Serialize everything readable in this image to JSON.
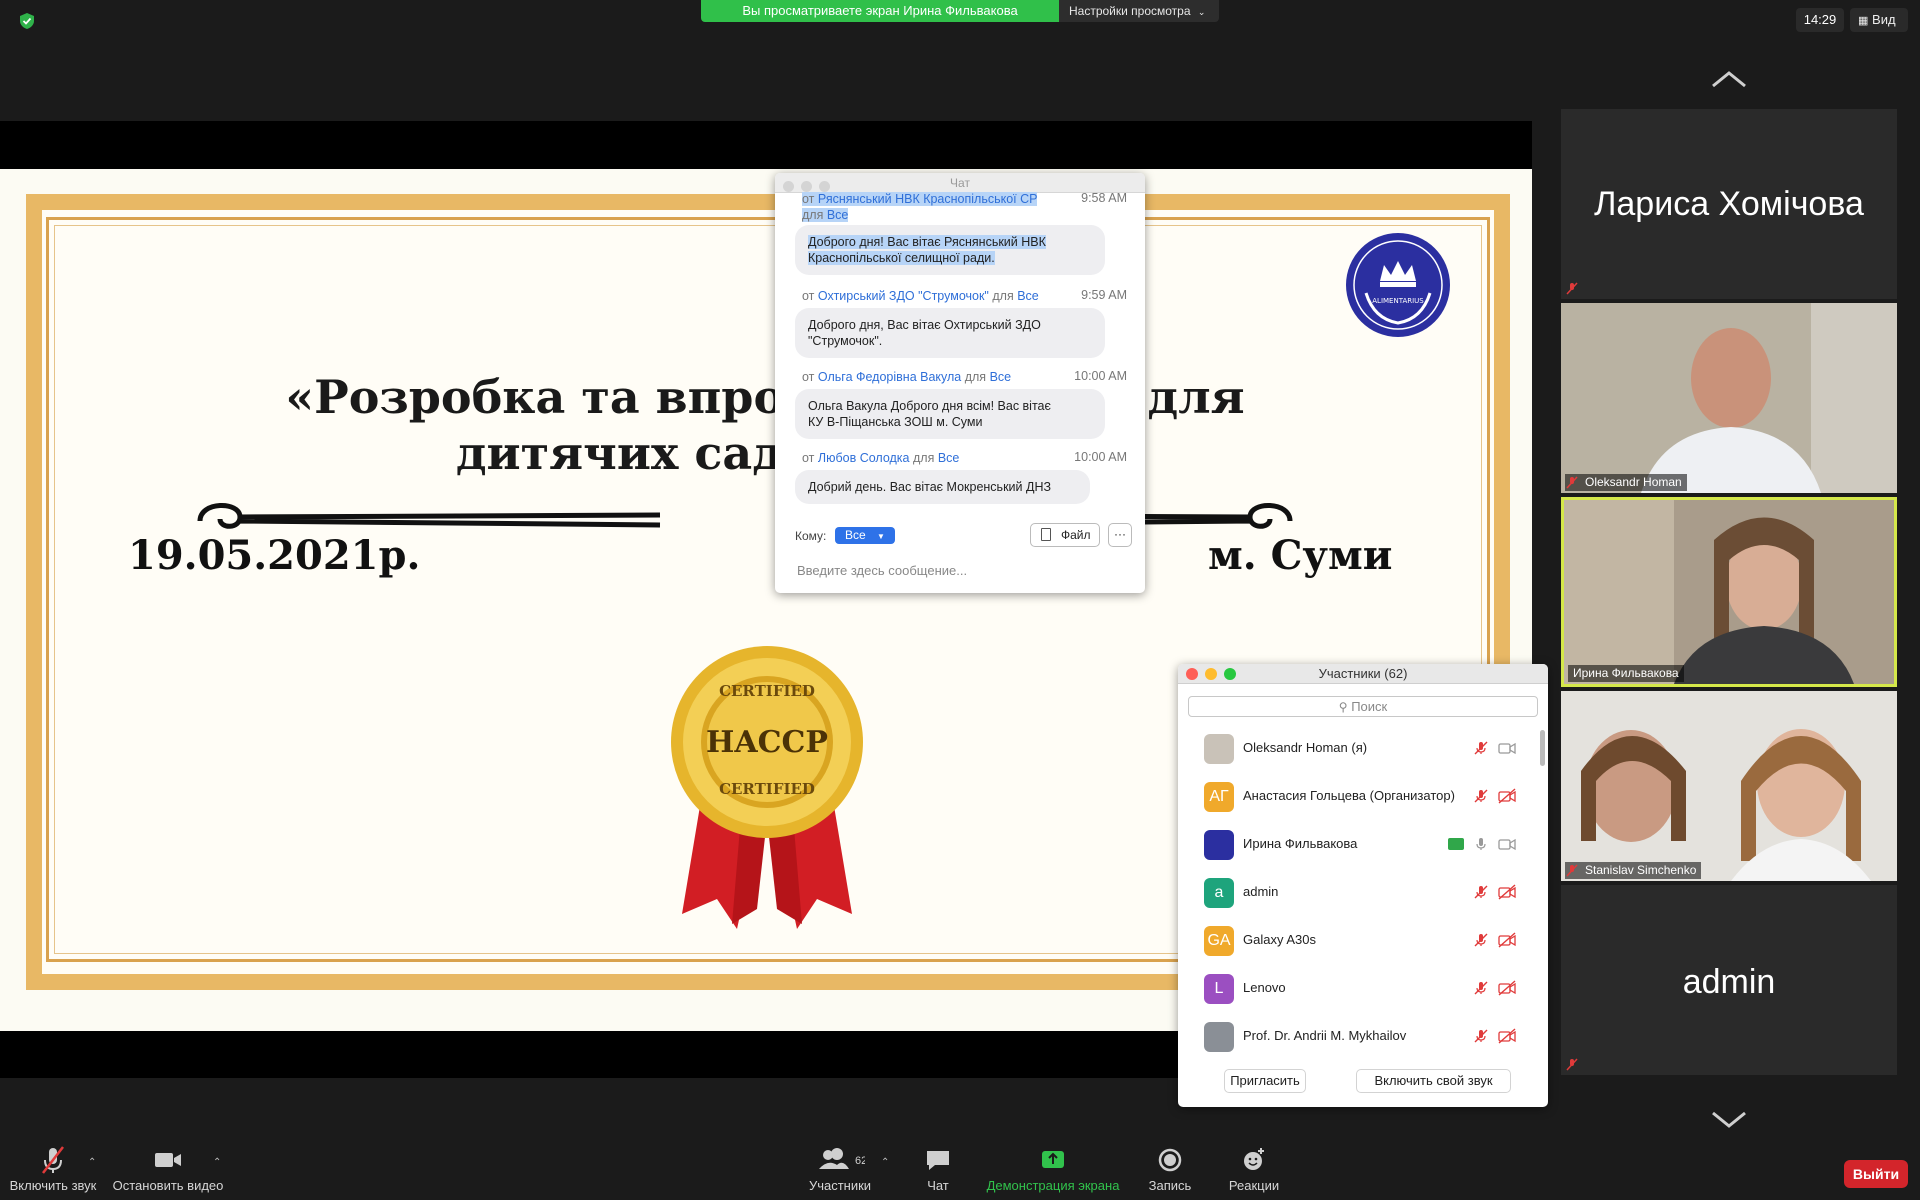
{
  "top": {
    "banner": "Вы просматриваете экран Ирина Фильвакова",
    "view_settings": "Настройки просмотра",
    "clock": "14:29",
    "view": "Вид"
  },
  "slide": {
    "title_line1": "«Розробка та впроваджен  ССР) для",
    "title_line2": "дитячих садків і ш   нь»",
    "date": "19.05.2021р.",
    "city": "м. Суми",
    "seal_top": "CERTIFIED",
    "seal_mid": "HACCP",
    "seal_bottom": "CERTIFIED",
    "logo_text": "ALIMENTARIUS"
  },
  "chat": {
    "title": "Чат",
    "messages": [
      {
        "from_prefix": "от",
        "sender": "Ряснянський НВК Краснопільської СР",
        "to_prefix": "для",
        "to": "Все",
        "time": "9:58 AM",
        "text1": "Доброго дня! Вас вітає Ряснянський НВК",
        "text2": "Краснопільської селищної ради."
      },
      {
        "from_prefix": "от",
        "sender": "Охтирський ЗДО \"Струмочок\"",
        "to_prefix": "для",
        "to": "Все",
        "time": "9:59 AM",
        "text1": "Доброго дня, Вас вітає Охтирський ЗДО",
        "text2": "\"Струмочок\"."
      },
      {
        "from_prefix": "от",
        "sender": "Ольга Федорівна Вакула",
        "to_prefix": "для",
        "to": "Все",
        "time": "10:00 AM",
        "text1": "Ольга Вакула Доброго дня всім! Вас вітає",
        "text2": "КУ В-Піщанська ЗОШ м. Суми"
      },
      {
        "from_prefix": "от",
        "sender": "Любов Солодка",
        "to_prefix": "для",
        "to": "Все",
        "time": "10:00 AM",
        "text1": "Добрий день. Вас вітає Мокренський ДНЗ",
        "text2": ""
      }
    ],
    "to_label": "Кому:",
    "to_value": "Все",
    "file_button": "Файл",
    "more_button": "···",
    "input_placeholder": "Введите здесь сообщение..."
  },
  "participants": {
    "title": "Участники (62)",
    "search_placeholder": "Поиск",
    "list": [
      {
        "initials": "",
        "name": "Oleksandr Homan (я)",
        "avatar_color": "#c9c2b8"
      },
      {
        "initials": "АГ",
        "name": "Анастасия Гольцева  (Организатор)",
        "avatar_color": "#f0a92b"
      },
      {
        "initials": "",
        "name": "Ирина Фильвакова",
        "avatar_color": "#2b2fa0"
      },
      {
        "initials": "a",
        "name": "admin",
        "avatar_color": "#1ea47c"
      },
      {
        "initials": "GA",
        "name": "Galaxy A30s",
        "avatar_color": "#f0a92b"
      },
      {
        "initials": "L",
        "name": "Lenovo",
        "avatar_color": "#9b4fc1"
      },
      {
        "initials": "",
        "name": "Prof. Dr. Andrii M. Mykhailov",
        "avatar_color": "#8a8f96"
      }
    ],
    "invite": "Пригласить",
    "unmute_self": "Включить свой звук"
  },
  "gallery": {
    "tile1_name": "Лариса Хомічова",
    "tile2_name": "Oleksandr Homan",
    "tile3_name": "Ирина Фильвакова",
    "tile4_name": "Stanislav Simchenko",
    "tile5_name": "admin"
  },
  "toolbar": {
    "unmute": "Включить звук",
    "stop_video": "Остановить видео",
    "participants": "Участники",
    "participants_count": "62",
    "chat": "Чат",
    "share": "Демонстрация экрана",
    "record": "Запись",
    "reactions": "Реакции",
    "leave": "Выйти"
  },
  "colors": {
    "share_green": "#30c04a",
    "leave_red": "#d3252b",
    "link_blue": "#2f6fd8",
    "active_speaker": "#d5e84a",
    "frame_gold": "#e8b865"
  }
}
